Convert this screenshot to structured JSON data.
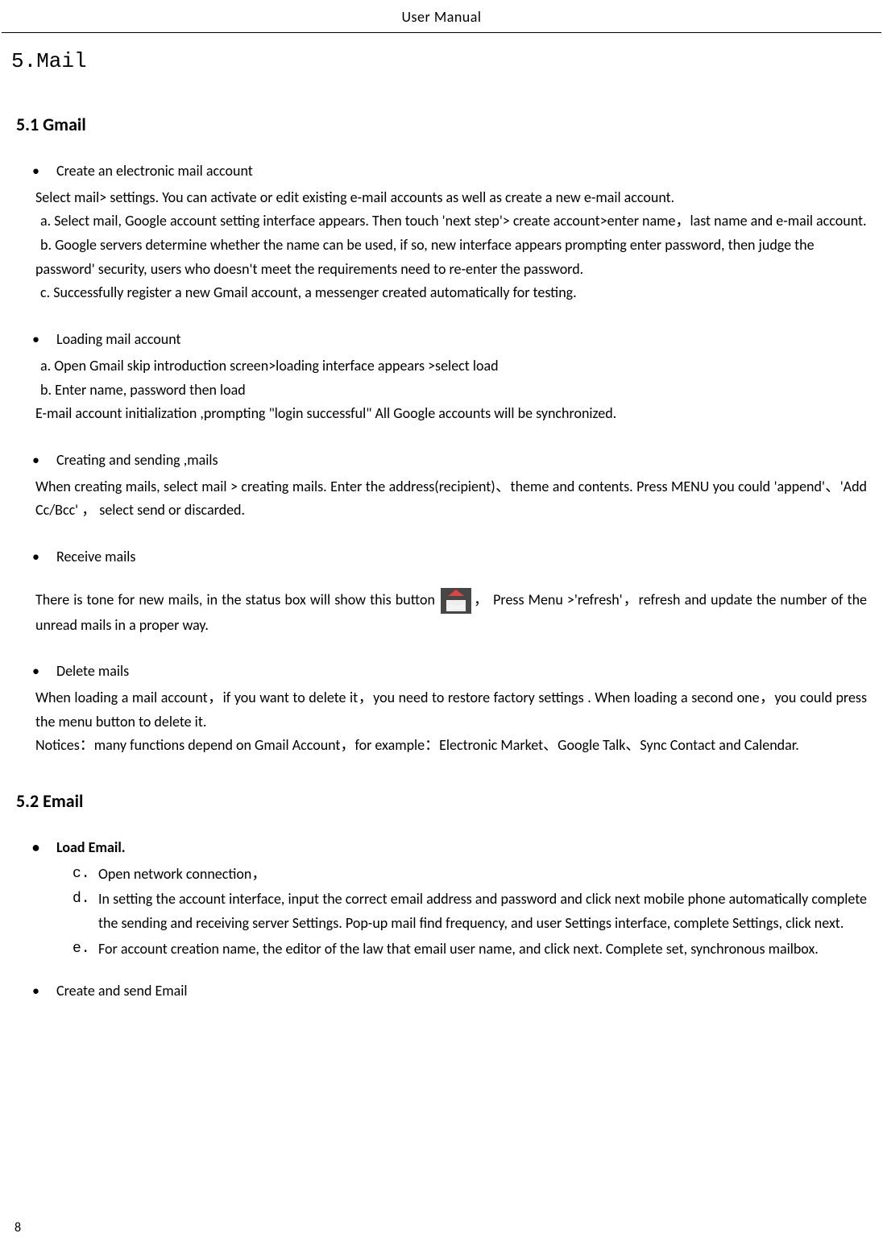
{
  "header": "User  Manual",
  "chapter": "5.Mail",
  "section_5_1": {
    "title": "5.1 Gmail",
    "create_account": {
      "bullet": "Create an electronic mail account",
      "intro": "Select mail> settings. You can activate or edit existing e-mail accounts as well as create a new e-mail account.",
      "a": "a.  Select mail, Google account setting interface appears. Then touch 'next step'> create account>enter name，last name and e-mail account.",
      "b": "b.  Google servers determine whether the name can be used, if so, new interface appears prompting enter password, then judge the password' security, users who doesn't meet the requirements need to re-enter the password.",
      "c": "c.  Successfully register a new Gmail account, a messenger created automatically for testing."
    },
    "loading": {
      "bullet": "Loading mail account",
      "a": "a. Open Gmail skip introduction screen>loading interface appears >select load",
      "b": "b. Enter name, password then load",
      "c": "E-mail account initialization ,prompting \"login successful\" All Google accounts will be synchronized."
    },
    "creating": {
      "bullet": "Creating and sending ,mails",
      "para": "When creating mails, select mail > creating mails. Enter the address(recipient)、theme and contents. Press MENU you could  'append'、'Add Cc/Bcc' ，  select send or discarded."
    },
    "receive": {
      "bullet": "Receive mails",
      "before_icon": "There is tone for new mails, in the status box will show this button ",
      "icon_name": "gmail-icon",
      "after_icon": "，  Press Menu >'refresh'，refresh and update the number of the unread mails in a proper way."
    },
    "delete": {
      "bullet": "Delete    mails",
      "para1": "When loading a mail account，if you want to delete it，you need to restore factory settings . When loading a second one，you could press the menu button to delete it.",
      "para2": "Notices：many functions depend on Gmail Account，for example：Electronic Market、Google Talk、Sync Contact and Calendar."
    }
  },
  "section_5_2": {
    "title": "5.2 Email",
    "load": {
      "bullet": "Load Email.",
      "c": "Open network connection，",
      "d": "In setting the account interface, input the correct email address and password and click next mobile phone automatically complete the sending and receiving server Settings. Pop-up mail find frequency, and user Settings interface, complete Settings, click next.",
      "e": "For account creation name, the editor of the law that email user name, and click next. Complete set, synchronous mailbox."
    },
    "create_send": {
      "bullet": "Create and send Email"
    }
  },
  "page_number": "8"
}
